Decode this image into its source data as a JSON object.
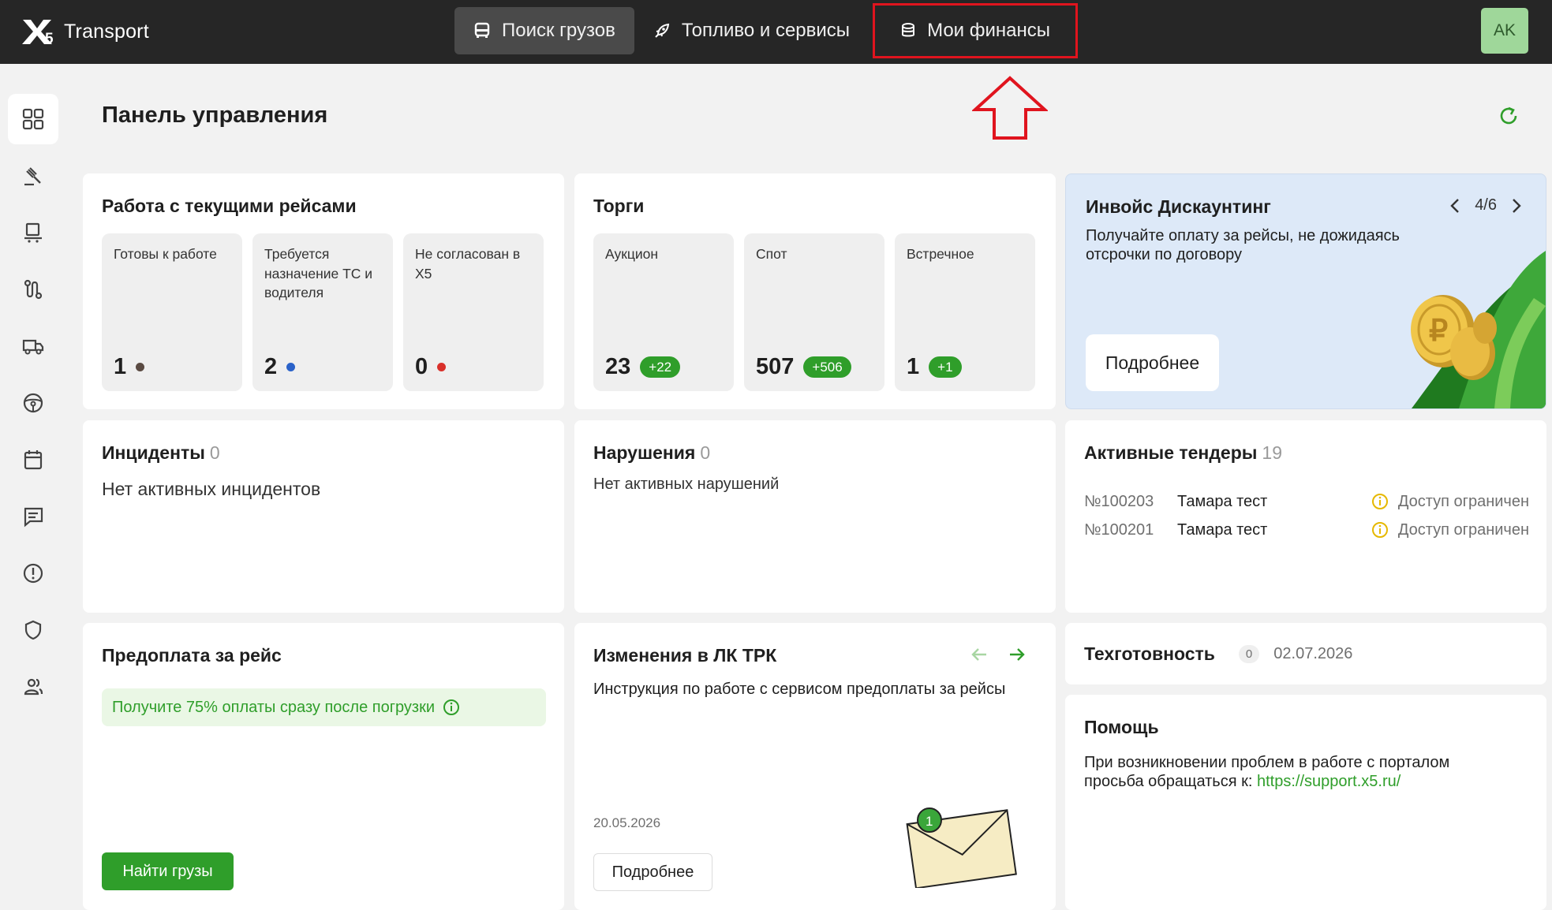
{
  "topbar": {
    "logo_text": "Transport",
    "nav": [
      {
        "label": "Поиск грузов"
      },
      {
        "label": "Топливо и сервисы"
      },
      {
        "label": "Мои финансы"
      }
    ],
    "avatar": "AK"
  },
  "page": {
    "title": "Панель управления"
  },
  "trips": {
    "title": "Работа с текущими рейсами",
    "tiles": [
      {
        "label": "Готовы к работе",
        "value": "1",
        "dot_color": "#5a4a42"
      },
      {
        "label": "Требуется назначение ТС и водителя",
        "value": "2",
        "dot_color": "#2a62c9"
      },
      {
        "label": "Не согласован в Х5",
        "value": "0",
        "dot_color": "#d9302a"
      }
    ]
  },
  "auctions": {
    "title": "Торги",
    "tiles": [
      {
        "label": "Аукцион",
        "value": "23",
        "delta": "+22"
      },
      {
        "label": "Спот",
        "value": "507",
        "delta": "+506"
      },
      {
        "label": "Встречное",
        "value": "1",
        "delta": "+1"
      }
    ]
  },
  "promo": {
    "title": "Инвойс Дискаунтинг",
    "pager": "4/6",
    "text": "Получайте оплату за рейсы, не дожидаясь отсрочки по договору",
    "button": "Подробнее"
  },
  "incidents": {
    "title": "Инциденты",
    "count": "0",
    "empty": "Нет активных инцидентов"
  },
  "violations": {
    "title": "Нарушения",
    "count": "0",
    "empty": "Нет активных нарушений"
  },
  "tenders": {
    "title": "Активные тендеры",
    "count": "19",
    "rows": [
      {
        "num": "№100203",
        "name": "Тамара тест",
        "status": "Доступ ограничен"
      },
      {
        "num": "№100201",
        "name": "Тамара тест",
        "status": "Доступ ограничен"
      }
    ]
  },
  "prepay": {
    "title": "Предоплата за рейс",
    "info": "Получите 75% оплаты сразу после погрузки",
    "button": "Найти грузы"
  },
  "changes": {
    "title": "Изменения в ЛК ТРК",
    "text": "Инструкция по работе с сервисом предоплаты за рейсы",
    "date": "20.05.2026",
    "button": "Подробнее",
    "envelope_badge": "1"
  },
  "tech": {
    "title": "Техготовность",
    "count": "0",
    "date": "02.07.2026"
  },
  "help": {
    "title": "Помощь",
    "text": "При возникновении проблем в работе с порталом просьба обращаться к: ",
    "link": "https://support.x5.ru/"
  },
  "colors": {
    "accent_green": "#2f9e2a",
    "topbar": "#262626",
    "annotation_red": "#e0141e"
  }
}
